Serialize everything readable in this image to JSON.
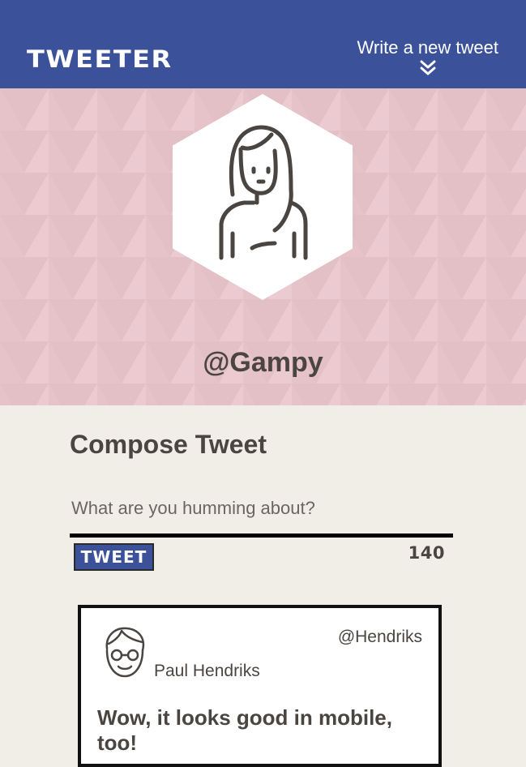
{
  "header": {
    "brand": "TWEETER",
    "write_link": "Write a new tweet",
    "write_icon": "double-chevron-down-icon"
  },
  "profile": {
    "handle": "@Gampy",
    "avatar_icon": "woman-avatar-icon"
  },
  "compose": {
    "title": "Compose Tweet",
    "placeholder": "What are you humming about?",
    "button_label": "TWEET",
    "char_count": "140"
  },
  "tweets": [
    {
      "avatar_icon": "man-with-glasses-avatar-icon",
      "name": "Paul Hendriks",
      "handle": "@Hendriks",
      "text": "Wow, it looks good in mobile, too!"
    }
  ],
  "colors": {
    "header_bg": "#3b529a",
    "hero_bg": "#e8c6cc",
    "page_bg": "#f1ede7",
    "text": "#4a4540"
  }
}
